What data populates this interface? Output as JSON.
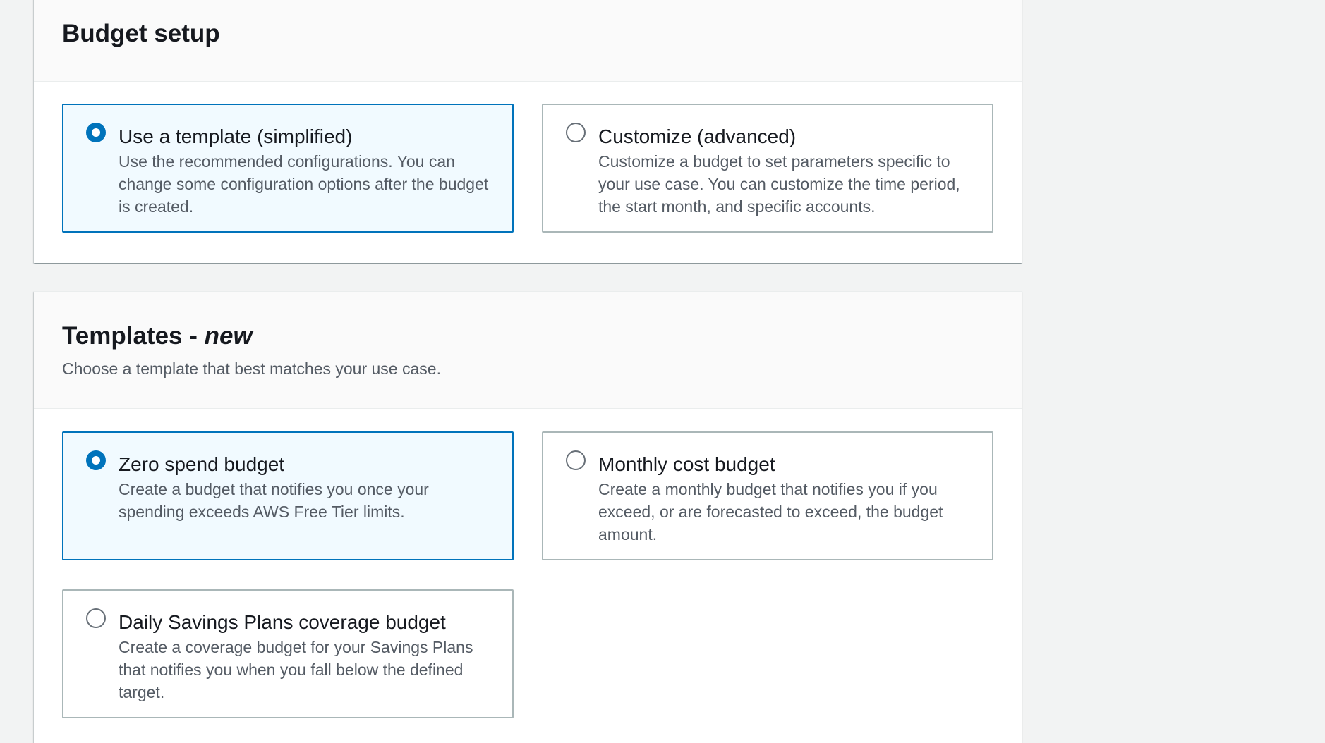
{
  "budget_setup": {
    "title": "Budget setup",
    "options": [
      {
        "label": "Use a template (simplified)",
        "description": "Use the recommended configurations. You can change some configuration options after the budget is created.",
        "selected": true
      },
      {
        "label": "Customize (advanced)",
        "description": "Customize a budget to set parameters specific to your use case. You can customize the time period, the start month, and specific accounts.",
        "selected": false
      }
    ]
  },
  "templates": {
    "title": "Templates - ",
    "title_badge": "new",
    "description": "Choose a template that best matches your use case.",
    "options": [
      {
        "label": "Zero spend budget",
        "description": "Create a budget that notifies you once your spending exceeds AWS Free Tier limits.",
        "selected": true
      },
      {
        "label": "Monthly cost budget",
        "description": "Create a monthly budget that notifies you if you exceed, or are forecasted to exceed, the budget amount.",
        "selected": false
      },
      {
        "label": "Daily Savings Plans coverage budget",
        "description": "Create a coverage budget for your Savings Plans that notifies you when you fall below the defined target.",
        "selected": false
      }
    ]
  },
  "colors": {
    "accent": "#0073bb",
    "selected_bg": "#f1faff",
    "border": "#aab7b8",
    "page_bg": "#f2f3f3"
  }
}
